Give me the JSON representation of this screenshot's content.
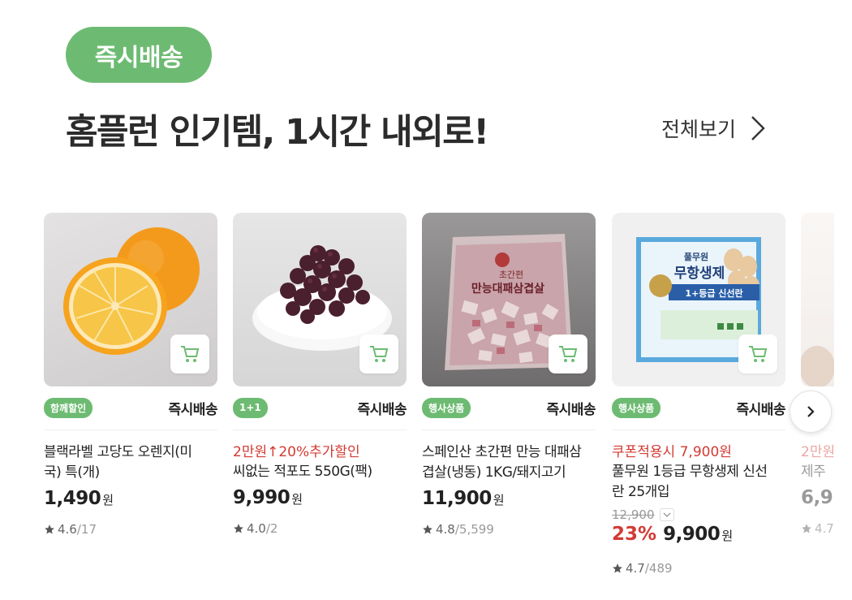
{
  "section": {
    "badge": "즉시배송",
    "headline": "홈플런 인기템, 1시간 내외로!",
    "view_all": "전체보기"
  },
  "colors": {
    "accent": "#6dbb72",
    "discount": "#d33a33"
  },
  "products": [
    {
      "tag": "함께할인",
      "delivery": "즉시배송",
      "promo": "",
      "name_line1": "블랙라벨 고당도 오렌지(미",
      "name_line2": "국) 특(개)",
      "price": "1,490",
      "won": "원",
      "rating": "4.6",
      "review_count": "/17",
      "image": "orange"
    },
    {
      "tag": "1+1",
      "delivery": "즉시배송",
      "promo": "2만원↑20%추가할인",
      "name_line1": "씨없는 적포도 550G(팩)",
      "name_line2": "",
      "price": "9,990",
      "won": "원",
      "rating": "4.0",
      "review_count": "/2",
      "image": "grapes"
    },
    {
      "tag": "행사상품",
      "delivery": "즉시배송",
      "promo": "",
      "name_line1": "스페인산 초간편 만능 대패삼",
      "name_line2": "겹살(냉동) 1KG/돼지고기",
      "price": "11,900",
      "won": "원",
      "rating": "4.8",
      "review_count": "/5,599",
      "image": "pork",
      "package_brand": "초간편",
      "package_title": "만능대패삼겹살"
    },
    {
      "tag": "행사상품",
      "delivery": "즉시배송",
      "promo": "쿠폰적용시 7,900원",
      "name_line1": "풀무원 1등급 무항생제 신선",
      "name_line2": "란 25개입",
      "original_price": "12,900",
      "discount": "23%",
      "price": "9,900",
      "won": "원",
      "rating": "4.7",
      "review_count": "/489",
      "image": "eggs",
      "package_brand": "풀무원",
      "package_title": "무항생제",
      "package_subtitle": "1+등급 신선란"
    },
    {
      "promo": "2만원",
      "name_line1": "제주",
      "price": "6,9",
      "rating": "4.7"
    }
  ],
  "icons": {
    "cart": "cart-icon",
    "star": "star-icon",
    "next": "chevron-right-icon",
    "view_all": "chevron-right-icon"
  }
}
